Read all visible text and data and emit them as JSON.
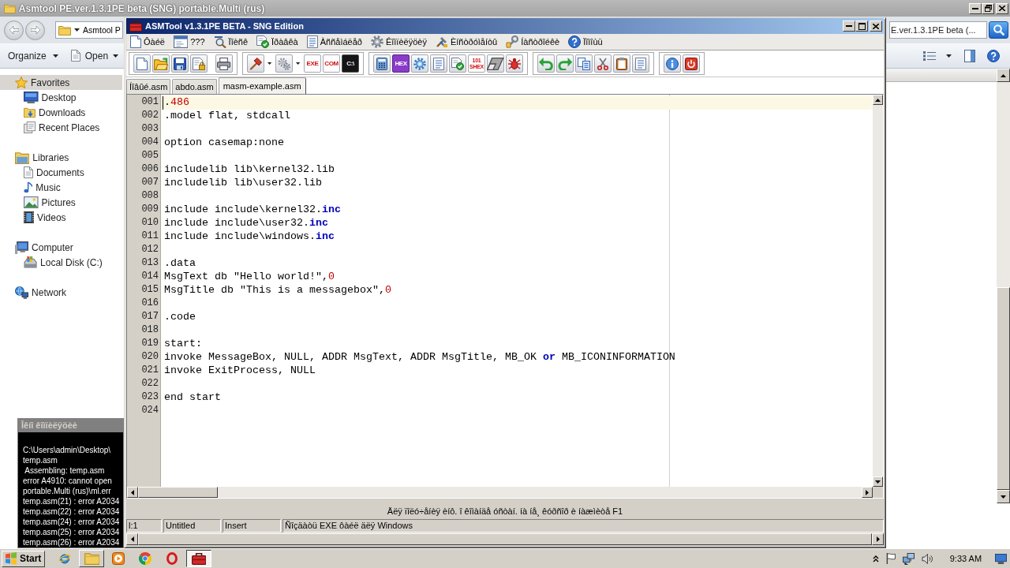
{
  "explorer": {
    "title": "Asmtool PE.ver.1.3.1PE beta (SNG) portable.Multi (rus)",
    "address": "Asmtool P",
    "search": {
      "placeholder": "E.ver.1.3.1PE beta (..."
    },
    "commands": [
      "Organize",
      "Open"
    ],
    "nav": [
      {
        "label": "Favorites",
        "selected": true,
        "children": [
          {
            "label": "Desktop",
            "selected": false
          },
          {
            "label": "Downloads",
            "selected": false
          },
          {
            "label": "Recent Places",
            "selected": false
          }
        ]
      },
      {
        "label": "Libraries",
        "selected": false,
        "children": [
          {
            "label": "Documents",
            "selected": false
          },
          {
            "label": "Music",
            "selected": false
          },
          {
            "label": "Pictures",
            "selected": false
          },
          {
            "label": "Videos",
            "selected": false
          }
        ]
      },
      {
        "label": "Computer",
        "selected": false,
        "children": [
          {
            "label": "Local Disk (C:)",
            "selected": false
          }
        ]
      },
      {
        "label": "Network",
        "selected": false
      }
    ]
  },
  "editor_window": {
    "title": "ASMTool v1.3.1PE BETA - SNG Edition",
    "menu": [
      "Ôàéë",
      "???",
      "Ïîèñê",
      "Ïðàâêà",
      "Àññåìáëåð",
      "Êîìïèëÿöèÿ",
      "Èíñòðóìåíòû",
      "Íàñòðîéêè",
      "Ïîìîùü"
    ],
    "toolbar": [
      [
        {
          "kind": "icon"
        },
        {
          "kind": "icon"
        },
        {
          "kind": "icon"
        },
        {
          "kind": "icon"
        },
        {
          "kind": "icon"
        }
      ],
      [
        {
          "kind": "icon"
        },
        {
          "kind": "dropdown"
        },
        {
          "kind": "icon"
        },
        {
          "kind": "dropdown"
        },
        {
          "kind": "text",
          "label": "EXE"
        },
        {
          "kind": "text",
          "label": "COM"
        },
        {
          "kind": "text",
          "label": "C:\\"
        }
      ],
      [
        {
          "kind": "icon"
        },
        {
          "kind": "text",
          "label": "HEX"
        },
        {
          "kind": "icon"
        },
        {
          "kind": "icon"
        },
        {
          "kind": "icon"
        },
        {
          "kind": "text",
          "label": "101 SHEX"
        },
        {
          "kind": "icon"
        },
        {
          "kind": "icon"
        }
      ],
      [
        {
          "kind": "icon"
        },
        {
          "kind": "icon"
        },
        {
          "kind": "icon"
        },
        {
          "kind": "icon"
        },
        {
          "kind": "icon"
        },
        {
          "kind": "icon"
        }
      ],
      [
        {
          "kind": "icon"
        },
        {
          "kind": "icon"
        }
      ]
    ],
    "tabs": [
      {
        "label": "Íîâûé.asm",
        "selected": false
      },
      {
        "label": "abdo.asm",
        "selected": false
      },
      {
        "label": "masm-example.asm",
        "selected": true
      }
    ],
    "code": [
      {
        "number": "001",
        "current": true,
        "tokens": [
          {
            "kind": "plain",
            "text": "."
          },
          {
            "kind": "number",
            "text": "486"
          }
        ]
      },
      {
        "number": "002",
        "current": false,
        "tokens": [
          {
            "kind": "plain",
            "text": ".model flat, stdcall"
          }
        ]
      },
      {
        "number": "003",
        "current": false
      },
      {
        "number": "004",
        "current": false,
        "tokens": [
          {
            "kind": "plain",
            "text": "option casemap:none"
          }
        ]
      },
      {
        "number": "005",
        "current": false
      },
      {
        "number": "006",
        "current": false,
        "tokens": [
          {
            "kind": "plain",
            "text": "includelib lib\\kernel32.lib"
          }
        ]
      },
      {
        "number": "007",
        "current": false,
        "tokens": [
          {
            "kind": "plain",
            "text": "includelib lib\\user32.lib"
          }
        ]
      },
      {
        "number": "008",
        "current": false
      },
      {
        "number": "009",
        "current": false,
        "tokens": [
          {
            "kind": "plain",
            "text": "include include\\kernel32."
          },
          {
            "kind": "keyword",
            "text": "inc"
          }
        ]
      },
      {
        "number": "010",
        "current": false,
        "tokens": [
          {
            "kind": "plain",
            "text": "include include\\user32."
          },
          {
            "kind": "keyword",
            "text": "inc"
          }
        ]
      },
      {
        "number": "011",
        "current": false,
        "tokens": [
          {
            "kind": "plain",
            "text": "include include\\windows."
          },
          {
            "kind": "keyword",
            "text": "inc"
          }
        ]
      },
      {
        "number": "012",
        "current": false
      },
      {
        "number": "013",
        "current": false,
        "tokens": [
          {
            "kind": "plain",
            "text": ".data"
          }
        ]
      },
      {
        "number": "014",
        "current": false,
        "tokens": [
          {
            "kind": "plain",
            "text": "MsgText db \"Hello world!\","
          },
          {
            "kind": "number",
            "text": "0"
          }
        ]
      },
      {
        "number": "015",
        "current": false,
        "tokens": [
          {
            "kind": "plain",
            "text": "MsgTitle db \"This is a messagebox\","
          },
          {
            "kind": "number",
            "text": "0"
          }
        ]
      },
      {
        "number": "016",
        "current": false
      },
      {
        "number": "017",
        "current": false,
        "tokens": [
          {
            "kind": "plain",
            "text": ".code"
          }
        ]
      },
      {
        "number": "018",
        "current": false
      },
      {
        "number": "019",
        "current": false,
        "tokens": [
          {
            "kind": "plain",
            "text": "start:"
          }
        ]
      },
      {
        "number": "020",
        "current": false,
        "tokens": [
          {
            "kind": "plain",
            "text": "invoke MessageBox, NULL, ADDR MsgText, ADDR MsgTitle, MB_OK "
          },
          {
            "kind": "keyword",
            "text": "or"
          },
          {
            "kind": "plain",
            "text": " MB_ICONINFORMATION"
          }
        ]
      },
      {
        "number": "021",
        "current": false,
        "tokens": [
          {
            "kind": "plain",
            "text": "invoke ExitProcess, NULL"
          }
        ]
      },
      {
        "number": "022",
        "current": false
      },
      {
        "number": "023",
        "current": false,
        "tokens": [
          {
            "kind": "plain",
            "text": "end start"
          }
        ]
      },
      {
        "number": "024",
        "current": false
      }
    ],
    "hint": "Äëÿ ïîëó÷åíèÿ èíô. î êîìàíäå óñòàí. íà íå¸ êóðñîð è íàæìèòå F1",
    "status": [
      "l:1",
      "Untitled",
      "Insert",
      "Ñîçäàòü EXE ôàéë äëÿ Windows"
    ]
  },
  "console": {
    "title": "Îêíî êîìïèëÿöèè",
    "lines": [
      "C:\\Users\\admin\\Desktop\\",
      "temp.asm",
      " Assembling: temp.asm",
      "error A4910: cannot open",
      "portable.Multi (rus)\\ml.err",
      "temp.asm(21) : error A2034",
      "temp.asm(22) : error A2034",
      "temp.asm(24) : error A2034",
      "temp.asm(25) : error A2034",
      "temp.asm(26) : error A2034"
    ]
  },
  "taskbar": {
    "start": "Start",
    "apps": [
      {
        "running": false,
        "selected": false
      },
      {
        "running": true,
        "selected": false
      },
      {
        "running": false,
        "selected": false
      },
      {
        "running": false,
        "selected": false
      },
      {
        "running": false,
        "selected": false
      },
      {
        "running": true,
        "selected": true
      }
    ],
    "clock": "9:33 AM"
  }
}
